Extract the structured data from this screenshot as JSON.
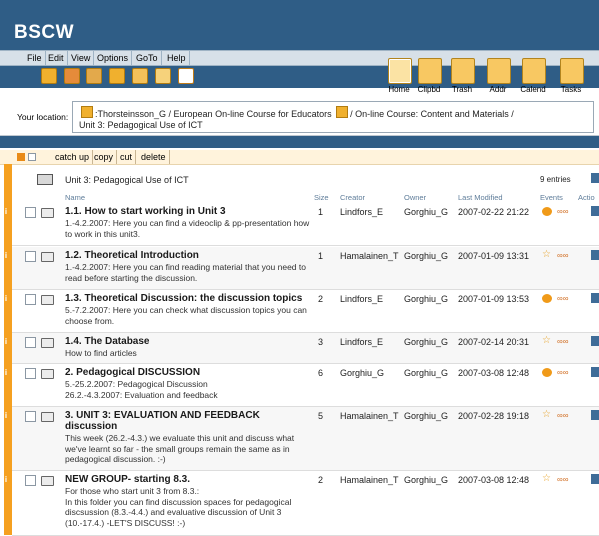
{
  "app": {
    "brand": "BSCW"
  },
  "menu": [
    {
      "label": "File"
    },
    {
      "label": "Edit"
    },
    {
      "label": "View"
    },
    {
      "label": "Options"
    },
    {
      "label": "GoTo"
    },
    {
      "label": "Help"
    }
  ],
  "toolbox": [
    {
      "label": "Home",
      "icon": "home-icon",
      "selected": true
    },
    {
      "label": "Clipbd",
      "icon": "clipboard-icon"
    },
    {
      "label": "Trash",
      "icon": "trash-icon"
    },
    {
      "label": "Addr",
      "icon": "address-book-icon"
    },
    {
      "label": "Calend",
      "icon": "calendar-icon"
    },
    {
      "label": "Tasks",
      "icon": "tasks-icon"
    }
  ],
  "location": {
    "label": "Your location:",
    "part1": ":Thorsteinsson_G / European On-line Course for Educators",
    "part2": "/ On-line Course: Content and Materials /",
    "part3": "Unit 3: Pedagogical Use of ICT"
  },
  "actions": [
    {
      "label": "catch up"
    },
    {
      "label": "copy"
    },
    {
      "label": "cut"
    },
    {
      "label": "delete"
    }
  ],
  "folder": {
    "name": "Unit 3: Pedagogical Use of ICT",
    "entries": "9 entries"
  },
  "columns": {
    "name": "Name",
    "size": "Size",
    "creator": "Creator",
    "owner": "Owner",
    "modified": "Last Modified",
    "events": "Events",
    "actions": "Actio"
  },
  "rows": [
    {
      "title": "1.1. How to start working in Unit 3",
      "desc": "1.-4.2.2007: Here you can find a videoclip & pp-presentation how to work in this unit3.",
      "size": "1",
      "creator": "Lindfors_E",
      "owner": "Gorghiu_G",
      "modified": "2007-02-22 21:22",
      "event": "blob"
    },
    {
      "title": "1.2. Theoretical Introduction",
      "desc": "1.-4.2.2007: Here you can find reading material that you need to read before starting the discussion.",
      "size": "1",
      "creator": "Hamalainen_T",
      "owner": "Gorghiu_G",
      "modified": "2007-01-09 13:31",
      "event": "star"
    },
    {
      "title": "1.3. Theoretical Discussion: the discussion topics",
      "desc": "5.-7.2.2007: Here you can check what discussion topics you can choose from.",
      "size": "2",
      "creator": "Lindfors_E",
      "owner": "Gorghiu_G",
      "modified": "2007-01-09 13:53",
      "event": "blob"
    },
    {
      "title": "1.4. The Database",
      "desc": "How to find articles",
      "size": "3",
      "creator": "Lindfors_E",
      "owner": "Gorghiu_G",
      "modified": "2007-02-14 20:31",
      "event": "star"
    },
    {
      "title": "2. Pedagogical DISCUSSION",
      "desc": "5.-25.2.2007: Pedagogical Discussion\n26.2.-4.3.2007: Evaluation and feedback",
      "size": "6",
      "creator": "Gorghiu_G",
      "owner": "Gorghiu_G",
      "modified": "2007-03-08 12:48",
      "event": "blob"
    },
    {
      "title": "3. UNIT 3: EVALUATION AND FEEDBACK\ndiscussion",
      "desc": "This week (26.2.-4.3.) we evaluate this unit and discuss what we've learnt so far - the small groups remain the same as in pedagogical discussion. :-)",
      "size": "5",
      "creator": "Hamalainen_T",
      "owner": "Gorghiu_G",
      "modified": "2007-02-28 19:18",
      "event": "star"
    },
    {
      "title": "NEW GROUP- starting 8.3.",
      "desc": "For those who start unit 3 from 8.3.:\nIn this folder you can find discussion spaces for pedagogical discsussion (8.3.-4.4.) and evaluative discussion of Unit 3 (10.-17.4.) -LET'S DISCUSS! :-)",
      "size": "2",
      "creator": "Hamalainen_T",
      "owner": "Gorghiu_G",
      "modified": "2007-03-08 12:48",
      "event": "star"
    }
  ]
}
